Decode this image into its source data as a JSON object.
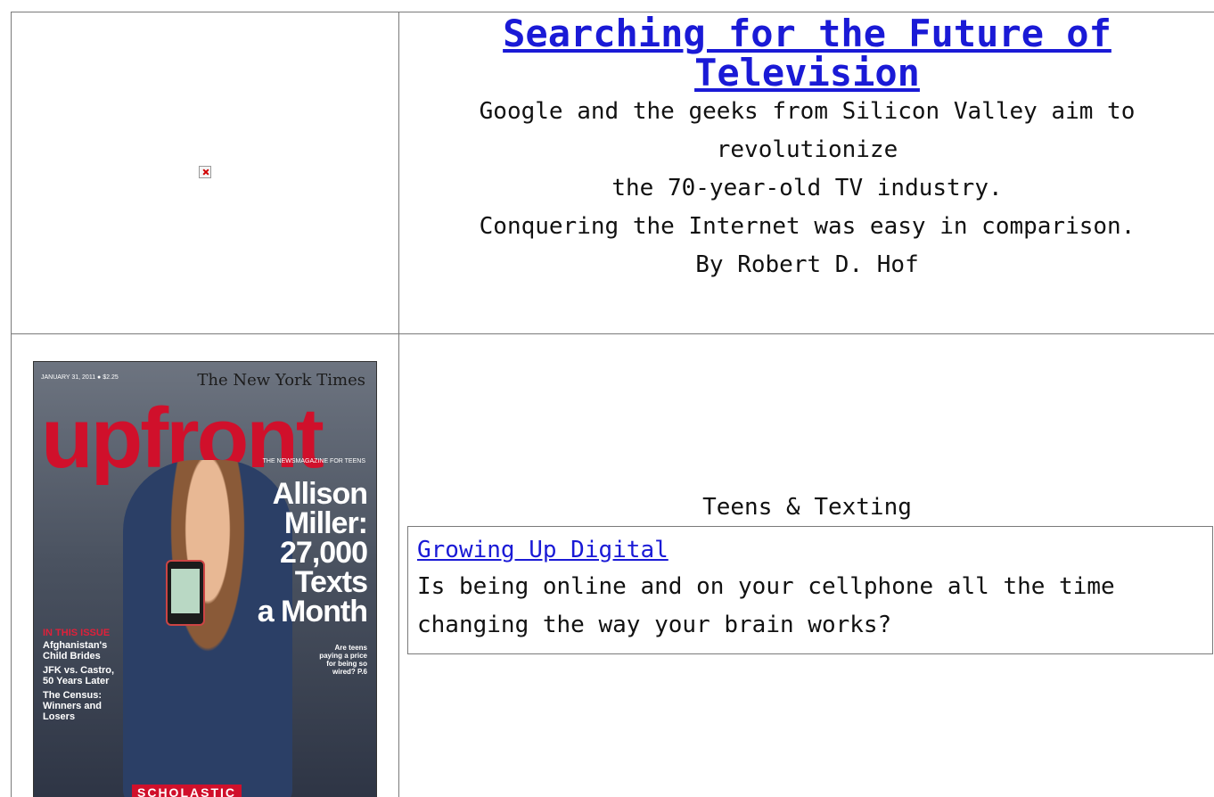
{
  "top_article": {
    "image_alt": "broken-image",
    "title_line1": "Searching for the Future of",
    "title_line2": "Television",
    "desc_line1": "Google and the geeks from Silicon Valley aim to",
    "desc_line2": "revolutionize",
    "desc_line3": "the 70-year-old TV industry.",
    "desc_line4": "Conquering the Internet was easy in comparison.",
    "byline": "By Robert D. Hof"
  },
  "cover": {
    "dateline": "JANUARY 31, 2011 ● $2.25",
    "nyt": "The New York Times",
    "masthead": "upfront",
    "tagline": "THE NEWSMAGAZINE FOR TEENS",
    "headline_1": "Allison",
    "headline_2": "Miller:",
    "headline_3": "27,000",
    "headline_4": "Texts",
    "headline_5": "a Month",
    "teaser": "Are teens paying a price for being so wired? P.6",
    "issue_label": "IN THIS ISSUE",
    "issue_items": [
      "Afghanistan's Child Brides",
      "JFK vs. Castro, 50 Years Later",
      "The Census: Winners and Losers"
    ],
    "publisher": "SCHOLASTIC"
  },
  "teens_section": {
    "heading": "Teens & Texting",
    "link": "Growing Up Digital",
    "desc_line1": "Is being online and on your cellphone all the time",
    "desc_line2": "changing the way your brain works?"
  },
  "colors": {
    "link": "#1a1ad6",
    "border": "#7a7a7a",
    "cover_red": "#d0102b"
  }
}
